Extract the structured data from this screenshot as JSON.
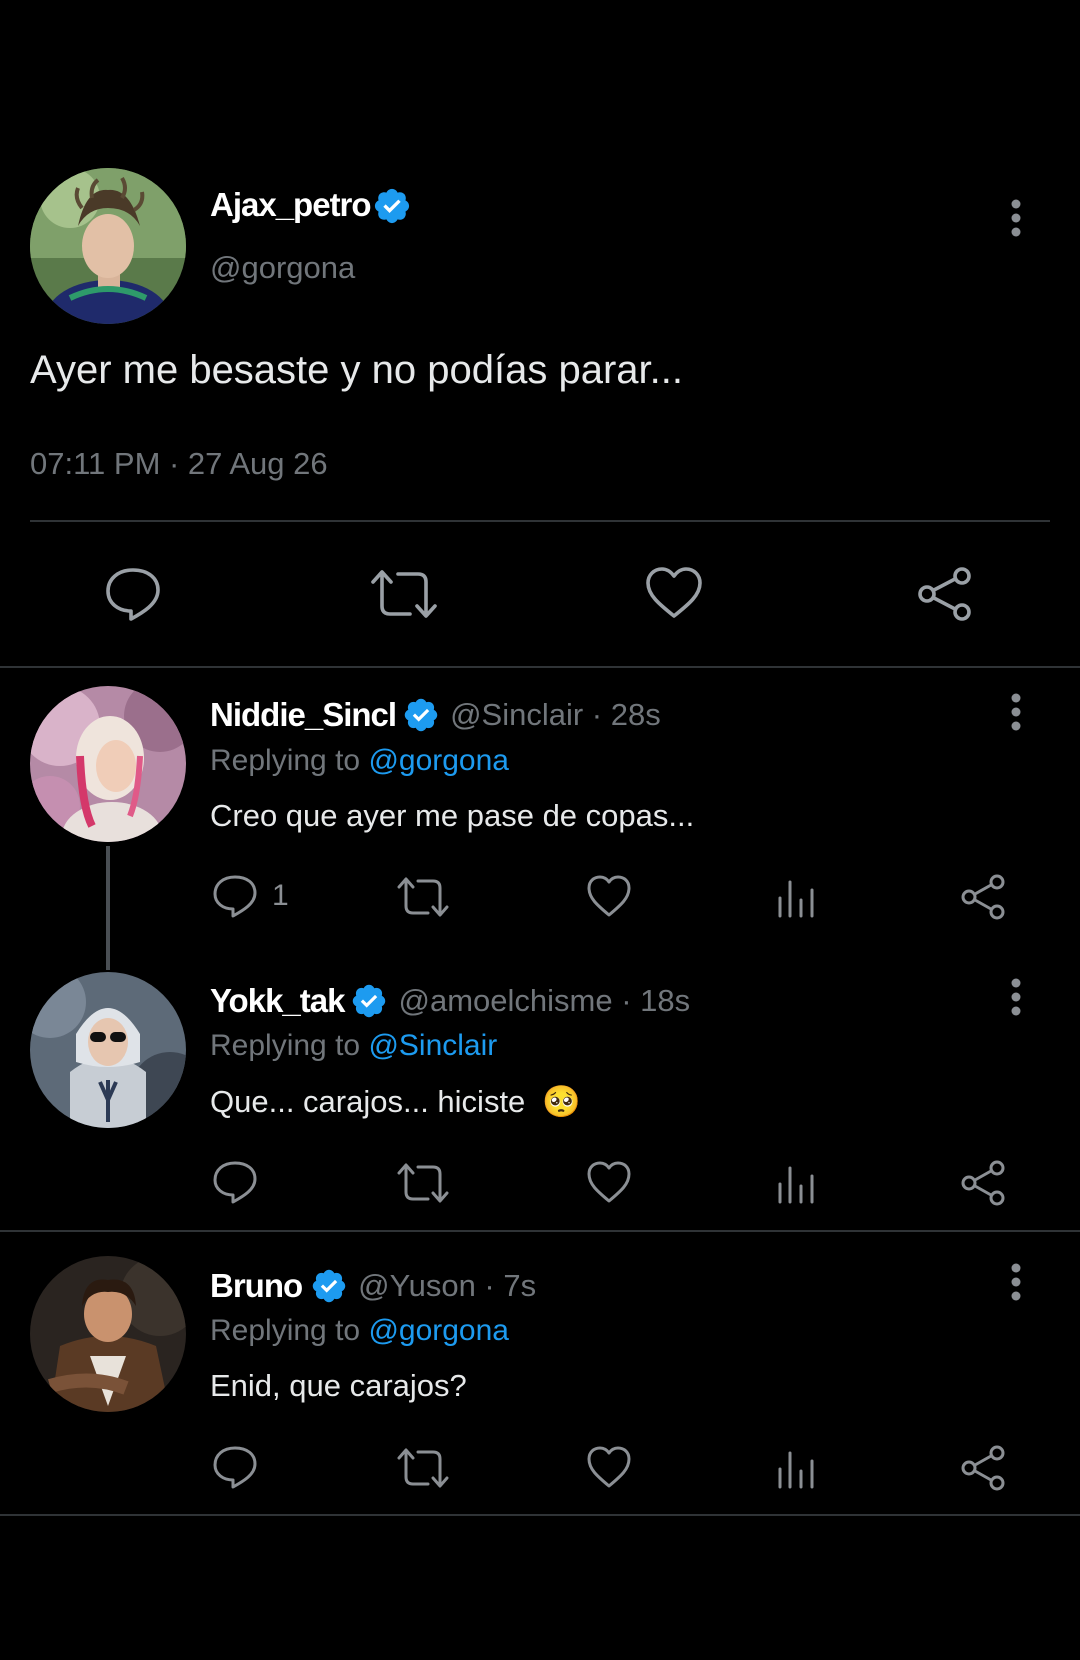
{
  "main_tweet": {
    "display_name": "Ajax_petro",
    "handle": "@gorgona",
    "text": "Ayer me besaste y no podías parar...",
    "timestamp": "07:11 PM · 27 Aug 26",
    "verified": true
  },
  "replies": [
    {
      "display_name": "Niddie_Sincl",
      "handle_time": "@Sinclair · 28s",
      "replying_label": "Replying to",
      "replying_to": "@gorgona",
      "text": "Creo que ayer me pase de copas...",
      "reply_count": "1",
      "verified": true
    },
    {
      "display_name": "Yokk_tak",
      "handle_time": "@amoelchisme · 18s",
      "replying_label": "Replying to",
      "replying_to": "@Sinclair",
      "text": "Que... carajos... hiciste",
      "emoji": "🥺",
      "reply_count": "",
      "verified": true
    },
    {
      "display_name": "Bruno",
      "handle_time": "@Yuson · 7s",
      "replying_label": "Replying to",
      "replying_to": "@gorgona",
      "text": "Enid, que carajos?",
      "reply_count": "",
      "verified": true
    }
  ],
  "icons": {
    "reply": "reply-icon",
    "retweet": "retweet-icon",
    "like": "heart-icon",
    "views": "analytics-icon",
    "share": "share-icon",
    "more": "more-options-icon",
    "verified": "verified-badge-icon"
  },
  "colors": {
    "background": "#000000",
    "text": "#e7e9ea",
    "muted": "#71767b",
    "link": "#1d9bf0",
    "verified": "#1d9bf0",
    "divider": "#2f3336"
  }
}
